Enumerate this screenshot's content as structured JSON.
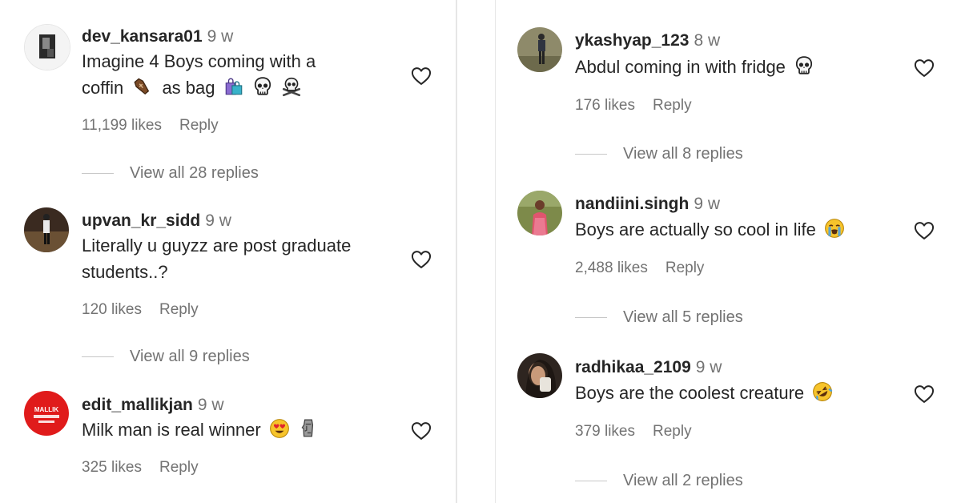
{
  "left_comments": [
    {
      "username": "dev_kansara01",
      "time": "9 w",
      "line1": "Imagine 4 Boys coming with a",
      "line2": "coffin",
      "line2_mid": "as bag",
      "likes": "11,199 likes",
      "reply": "Reply",
      "view_replies": "View all 28 replies"
    },
    {
      "username": "upvan_kr_sidd",
      "time": "9 w",
      "line1": "Literally u guyzz are post graduate",
      "line2": "students..?",
      "likes": "120 likes",
      "reply": "Reply",
      "view_replies": "View all 9 replies"
    },
    {
      "username": "edit_mallikjan",
      "time": "9 w",
      "line1": "Milk man is real winner",
      "likes": "325 likes",
      "reply": "Reply",
      "avatar_text": "MALLIK"
    }
  ],
  "right_comments": [
    {
      "username": "ykashyap_123",
      "time": "8 w",
      "line1": "Abdul coming in with fridge",
      "likes": "176 likes",
      "reply": "Reply",
      "view_replies": "View all 8 replies"
    },
    {
      "username": "nandiini.singh",
      "time": "9 w",
      "line1": "Boys are actually so cool in life",
      "likes": "2,488 likes",
      "reply": "Reply",
      "view_replies": "View all 5 replies"
    },
    {
      "username": "radhikaa_2109",
      "time": "9 w",
      "line1": "Boys are the coolest creature",
      "likes": "379 likes",
      "reply": "Reply",
      "view_replies": "View all 2 replies"
    }
  ],
  "icons": {
    "like": "heart-outline-icon",
    "emojis": [
      "coffin-emoji",
      "shopping-bags-emoji",
      "skull-emoji",
      "skull-and-crossbones-emoji",
      "heart-eyes-emoji",
      "moai-emoji",
      "loudly-crying-emoji",
      "rolling-on-floor-laughing-emoji"
    ]
  },
  "colors": {
    "text": "#262626",
    "secondary": "#737373",
    "background": "#ffffff",
    "divider": "#e6e6e6"
  }
}
